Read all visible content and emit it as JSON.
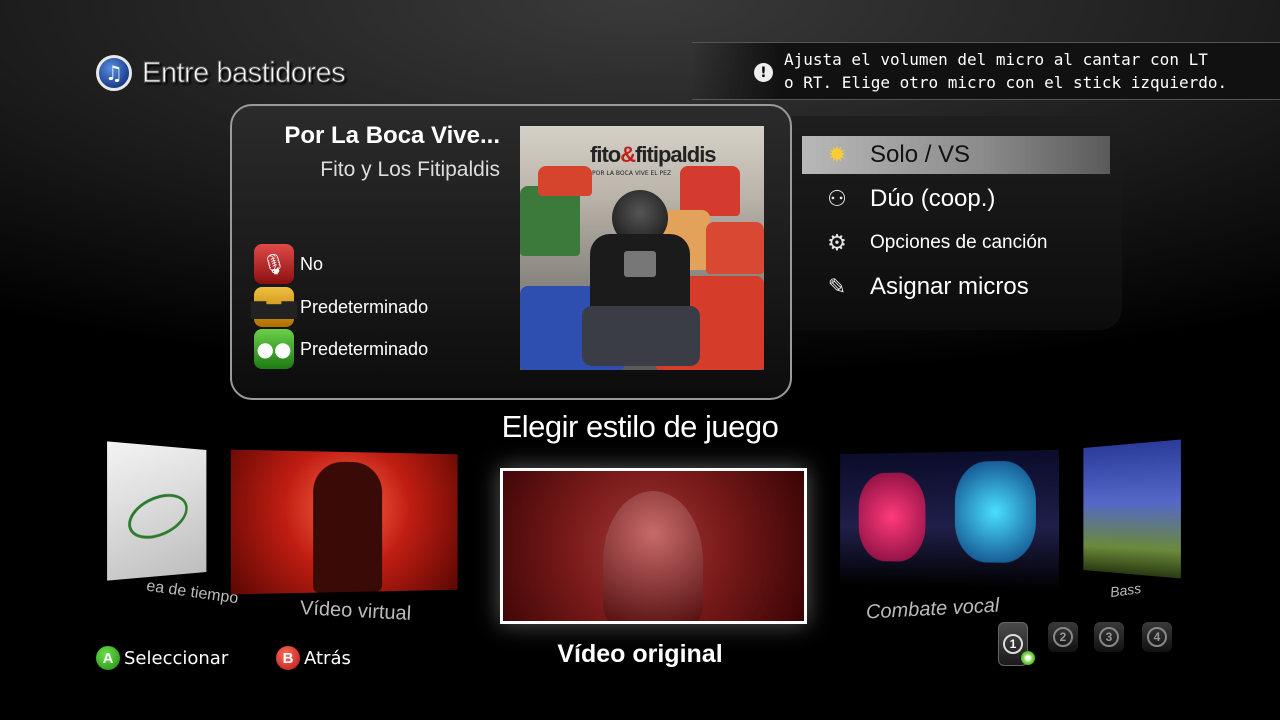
{
  "header": {
    "title": "Entre bastidores",
    "icon": "music-note-icon"
  },
  "hint": {
    "icon": "warning-icon",
    "line1": "Ajusta el volumen del micro al cantar con LT",
    "line2": "o RT. Elige otro micro con el stick izquierdo."
  },
  "song": {
    "title": "Por La Boca Vive...",
    "artist": "Fito y Los Fitipaldis",
    "options": [
      {
        "icon": "microphone-icon",
        "label": "No"
      },
      {
        "icon": "equalizer-icon",
        "label": "Predeterminado"
      },
      {
        "icon": "speech-bubbles-icon",
        "label": "Predeterminado"
      }
    ],
    "album": {
      "banner_left": "fito",
      "banner_amp": "&",
      "banner_right": "fitipaldis",
      "subtitle": "POR LA BOCA VIVE EL PEZ"
    }
  },
  "modes": [
    {
      "icon": "burst-icon",
      "label": "Solo / VS",
      "selected": true
    },
    {
      "icon": "duet-icon",
      "label": "Dúo (coop.)",
      "selected": false
    },
    {
      "icon": "gear-icon",
      "label": "Opciones de canción",
      "selected": false
    },
    {
      "icon": "magic-wand-icon",
      "label": "Asignar micros",
      "selected": false
    }
  ],
  "carousel": {
    "title": "Elegir estilo de juego",
    "tiles": [
      {
        "label": "ea de tiempo"
      },
      {
        "label": "Vídeo virtual"
      },
      {
        "label": "Vídeo original"
      },
      {
        "label": "Combate vocal"
      },
      {
        "label": "Bass"
      }
    ]
  },
  "controls": {
    "select_button": "A",
    "select_label": "Seleccionar",
    "back_button": "B",
    "back_label": "Atrás"
  },
  "players": [
    "1",
    "2",
    "3",
    "4"
  ],
  "colors": {
    "accent_green": "#3fb82a",
    "accent_red": "#d0302a",
    "selection_gray": "#a8a8a8"
  }
}
